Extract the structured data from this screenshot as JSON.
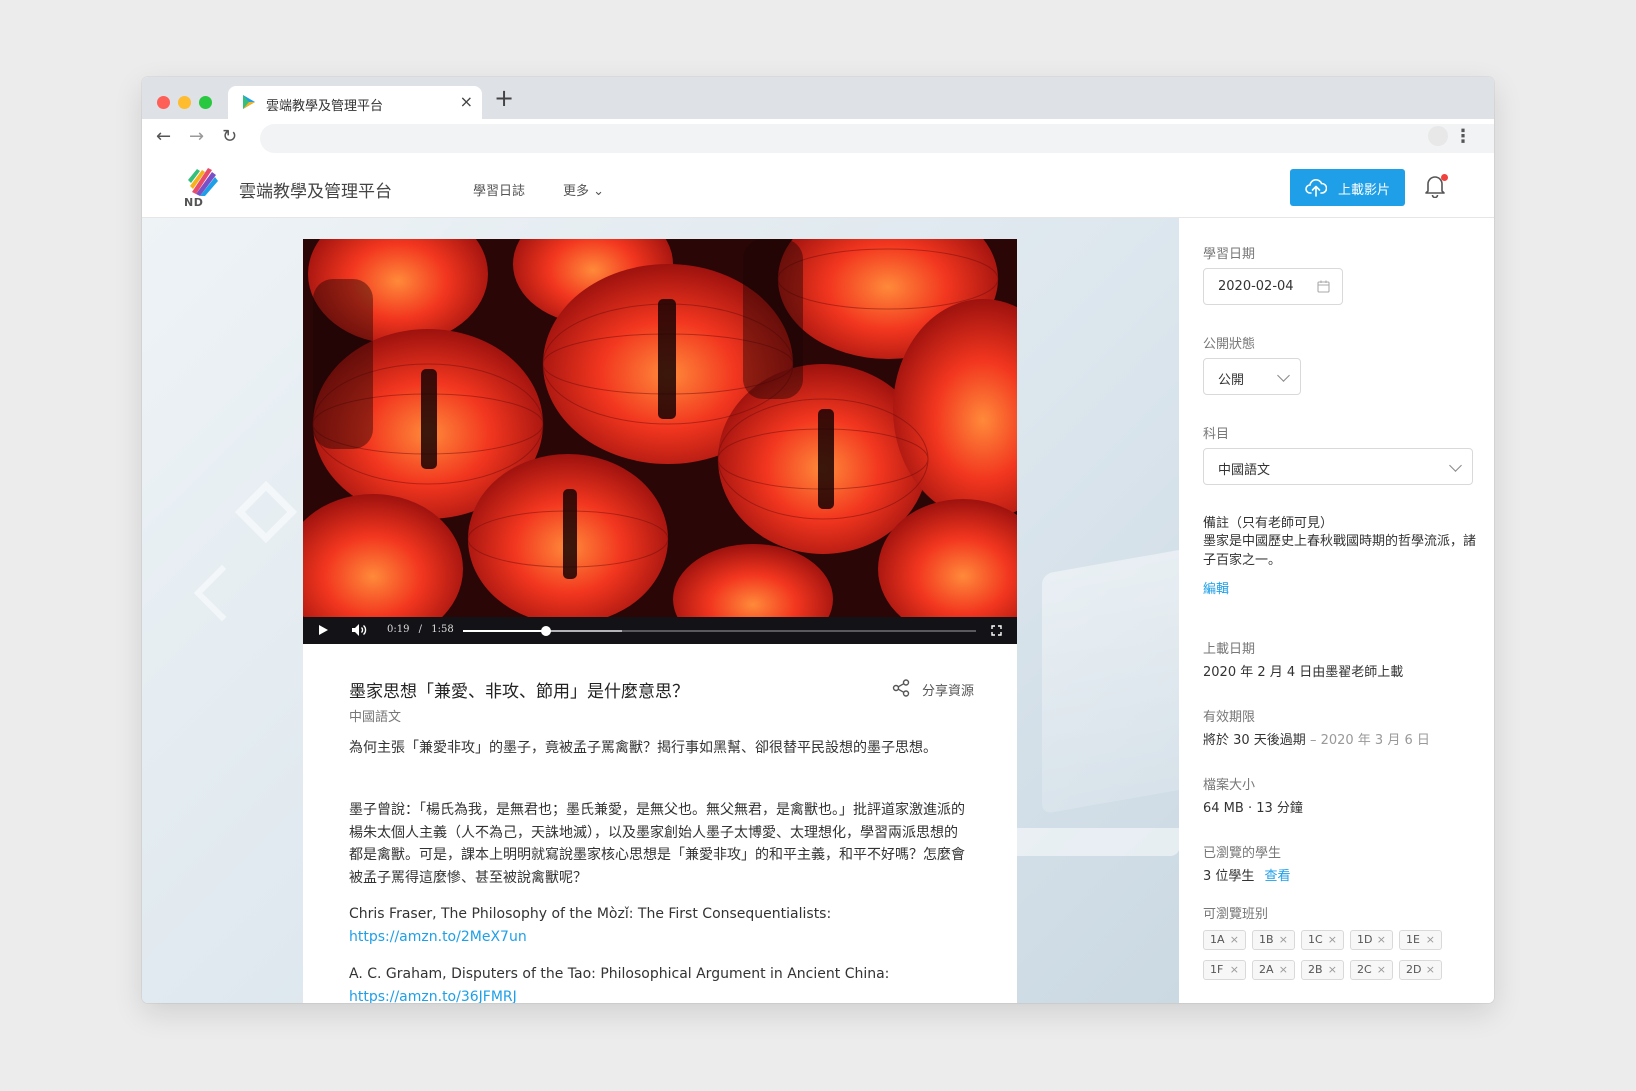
{
  "browser": {
    "tab_title": "雲端教學及管理平台",
    "close_glyph": "×",
    "new_tab_glyph": "+",
    "back_glyph": "←",
    "forward_glyph": "→",
    "reload_glyph": "↻",
    "star_glyph": "☆",
    "menu_glyph": "⋮"
  },
  "header": {
    "logo_text": "ND",
    "brand": "雲端教學及管理平台",
    "nav_diary": "學習日誌",
    "nav_more": "更多 ⌄",
    "upload_label": "上載影片",
    "accent": "#1e9fe8",
    "notification_dot": "#f0413c"
  },
  "video": {
    "current_time": "0:19",
    "separator": "/",
    "duration": "1:58",
    "progress_fraction": 0.161,
    "buffered_fraction": 0.31
  },
  "content": {
    "title": "墨家思想「兼愛、非攻、節用」是什麼意思？",
    "subject": "中國語文",
    "share_label": "分享資源",
    "para1": "為何主張「兼愛非攻」的墨子，竟被孟子罵禽獸？揭行事如黑幫、卻很替平民設想的墨子思想。",
    "para2": "墨子曾說：「楊氏為我，是無君也；墨氏兼愛，是無父也。無父無君，是禽獸也。」批評道家激進派的楊朱太個人主義（人不為己，天誅地滅），以及墨家創始人墨子太博愛、太理想化，學習兩派思想的都是禽獸。可是，課本上明明就寫說墨家核心思想是「兼愛非攻」的和平主義，和平不好嗎？怎麼會被孟子罵得這麼慘、甚至被說禽獸呢？",
    "ref1_text": "Chris Fraser, The Philosophy of the Mòzǐ: The First Consequentialists:",
    "ref1_link": "https://amzn.to/2MeX7un",
    "ref2_text": "A. C. Graham, Disputers of the Tao: Philosophical Argument in Ancient China:",
    "ref2_link": "https://amzn.to/36JFMRJ"
  },
  "sidebar": {
    "study_date_label": "學習日期",
    "study_date_value": "2020-02-04",
    "visibility_label": "公開狀態",
    "visibility_value": "公開",
    "subject_label": "科目",
    "subject_value": "中國語文",
    "note_label": "備註（只有老師可見）",
    "note_text": "墨家是中國歷史上春秋戰國時期的哲學流派，諸子百家之一。",
    "edit_label": "編輯",
    "upload_date_label": "上載日期",
    "upload_date_value": "2020 年 2 月 4 日由墨翟老師上載",
    "expiry_label": "有效期限",
    "expiry_value": "將於 30 天後過期",
    "expiry_date": "– 2020 年 3 月 6 日",
    "size_label": "檔案大小",
    "size_value": "64 MB · 13 分鐘",
    "viewed_label": "已瀏覽的學生",
    "viewed_value": "3 位學生",
    "viewed_link": "查看",
    "classes_label": "可瀏覽班别",
    "classes": [
      "1A",
      "1B",
      "1C",
      "1D",
      "1E",
      "1F",
      "2A",
      "2B",
      "2C",
      "2D"
    ],
    "chip_close": "×"
  }
}
